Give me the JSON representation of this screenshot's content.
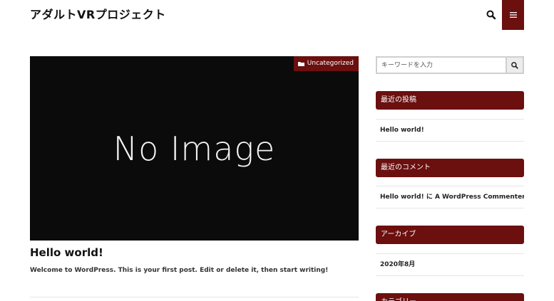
{
  "site": {
    "title": "アダルトVRプロジェクト"
  },
  "header": {
    "search_icon": "search-icon",
    "menu_icon": "hamburger-menu-icon"
  },
  "post": {
    "thumbnail_text": "No Image",
    "category": "Uncategorized",
    "category_icon": "folder-icon",
    "title": "Hello world!",
    "excerpt": "Welcome to WordPress. This is your first post. Edit or delete it, then start writing!"
  },
  "sidebar": {
    "search_placeholder": "キーワードを入力",
    "widgets": [
      {
        "heading": "最近の投稿",
        "items": [
          "Hello world!"
        ]
      },
      {
        "heading": "最近のコメント",
        "items": [
          "Hello world! に A WordPress Commenter より"
        ]
      },
      {
        "heading": "アーカイブ",
        "items": [
          "2020年8月"
        ]
      },
      {
        "heading": "カテゴリー",
        "items": []
      }
    ]
  },
  "colors": {
    "accent": "#6b0f0f",
    "thumbnail_bg": "#0b0b0b"
  }
}
